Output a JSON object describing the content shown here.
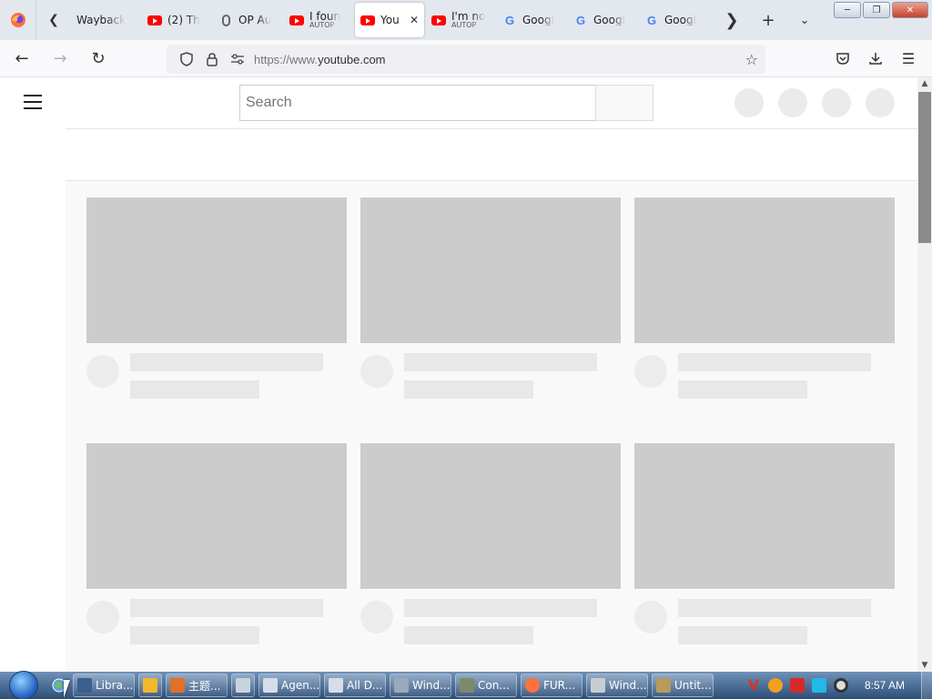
{
  "browser": {
    "tabs": [
      {
        "title": "Wayback",
        "sub": "",
        "favicon": "wayback-icon"
      },
      {
        "title": "(2) Th",
        "sub": "",
        "favicon": "youtube-icon"
      },
      {
        "title": "OP Au",
        "sub": "",
        "favicon": "mouse-icon"
      },
      {
        "title": "I foun",
        "sub": "AUTOP",
        "favicon": "youtube-icon"
      },
      {
        "title": "You",
        "sub": "",
        "favicon": "youtube-icon",
        "active": true
      },
      {
        "title": "I'm no",
        "sub": "AUTOP",
        "favicon": "youtube-icon"
      },
      {
        "title": "Googl",
        "sub": "",
        "favicon": "google-icon"
      },
      {
        "title": "Googl",
        "sub": "",
        "favicon": "google-icon"
      },
      {
        "title": "Googl",
        "sub": "",
        "favicon": "google-icon"
      }
    ],
    "url_domain": "youtube.com",
    "url_prefix": "https://www.",
    "accent": "#ff0000"
  },
  "page": {
    "search_placeholder": "Search"
  },
  "taskbar": {
    "buttons": [
      {
        "label": "Libra..."
      },
      {
        "label": ""
      },
      {
        "label": "主题..."
      },
      {
        "label": ""
      },
      {
        "label": "Agen..."
      },
      {
        "label": "All D..."
      },
      {
        "label": "Wind..."
      },
      {
        "label": "Con..."
      },
      {
        "label": "FUR..."
      },
      {
        "label": "Wind..."
      },
      {
        "label": "Untit..."
      }
    ],
    "clock": "8:57 AM"
  }
}
